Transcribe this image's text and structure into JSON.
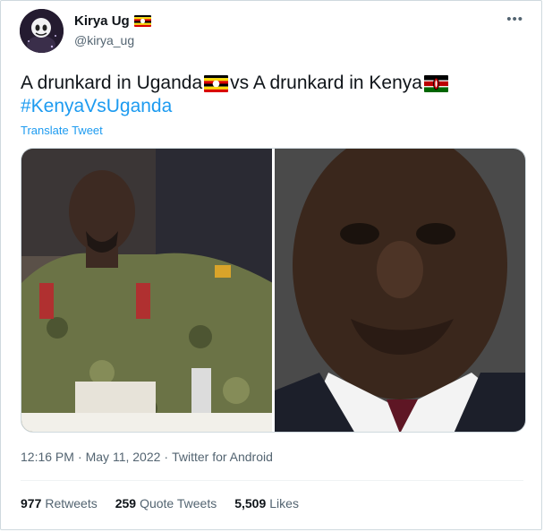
{
  "author": {
    "name": "Kirya Ug",
    "handle": "@kirya_ug"
  },
  "tweet": {
    "text_part1": "A drunkard in Uganda",
    "text_part2": " vs A drunkard in Kenya",
    "hashtag": "#KenyaVsUganda",
    "translate": "Translate Tweet"
  },
  "icons": {
    "more": "more-horizontal-icon",
    "flag_uganda": "uganda-flag-icon",
    "flag_kenya": "kenya-flag-icon"
  },
  "meta": {
    "time": "12:16 PM",
    "sep1": "·",
    "date": "May 11, 2022",
    "sep2": "·",
    "source": "Twitter for Android"
  },
  "stats": {
    "retweets_count": "977",
    "retweets_label": "Retweets",
    "quotes_count": "259",
    "quotes_label": "Quote Tweets",
    "likes_count": "5,509",
    "likes_label": "Likes"
  },
  "colors": {
    "link": "#1d9bf0",
    "secondary_text": "#536471",
    "primary_text": "#0f1419"
  }
}
